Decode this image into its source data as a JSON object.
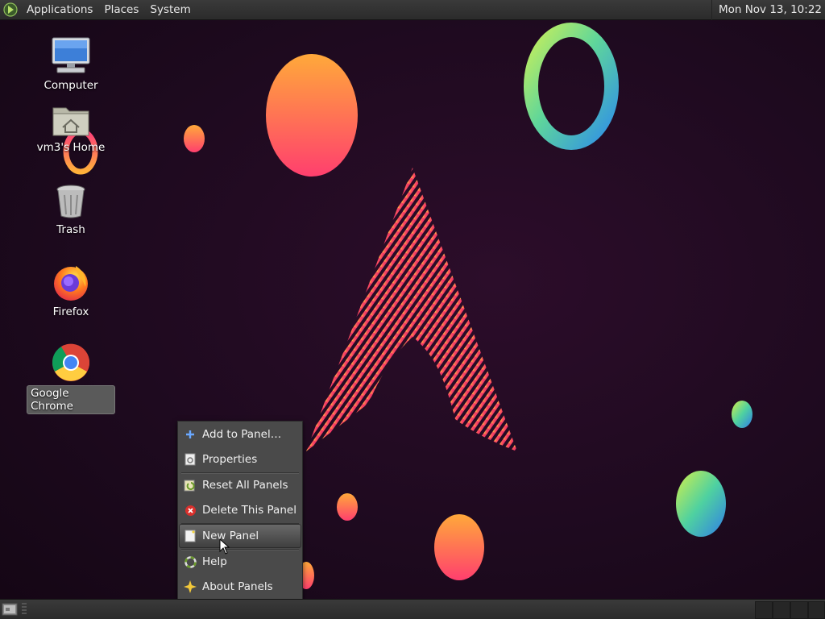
{
  "top_panel": {
    "menus": [
      "Applications",
      "Places",
      "System"
    ],
    "clock": "Mon Nov 13, 10:22"
  },
  "desktop": {
    "icons": [
      {
        "label": "Computer",
        "icon": "computer-icon"
      },
      {
        "label": "vm3's Home",
        "icon": "home-folder-icon"
      },
      {
        "label": "Trash",
        "icon": "trash-icon"
      },
      {
        "label": "Firefox",
        "icon": "firefox-icon"
      },
      {
        "label": "Google Chrome",
        "icon": "chrome-icon",
        "selected": true
      }
    ]
  },
  "context_menu": {
    "items": [
      {
        "label": "Add to Panel…",
        "icon": "add-icon"
      },
      {
        "label": "Properties",
        "icon": "properties-icon"
      },
      {
        "label": "Reset All Panels",
        "icon": "reset-icon"
      },
      {
        "label": "Delete This Panel",
        "icon": "delete-icon"
      },
      {
        "label": "New Panel",
        "icon": "new-panel-icon",
        "highlighted": true
      },
      {
        "label": "Help",
        "icon": "help-icon"
      },
      {
        "label": "About Panels",
        "icon": "about-icon"
      }
    ]
  },
  "colors": {
    "panel": "#2f2f2f",
    "desktop_bg": "#1e0a1f",
    "menu_bg": "#4a4a4a",
    "accent_pink": "#e8246e",
    "accent_orange": "#f7a53a"
  }
}
